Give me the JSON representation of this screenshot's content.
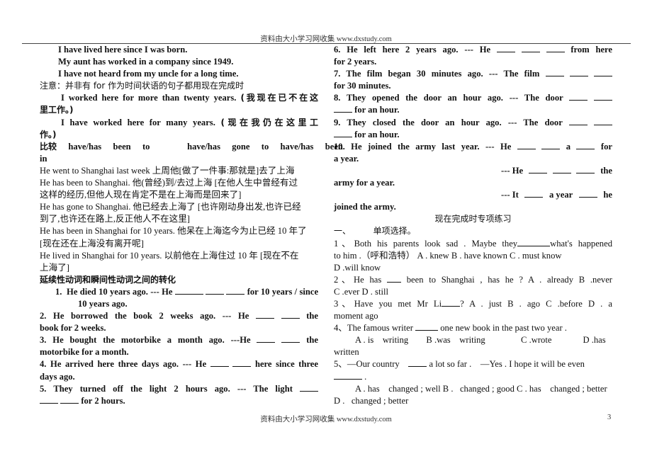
{
  "header": {
    "text": "资料由大小学习网收集  www.dxstudy.com"
  },
  "footer": {
    "text": "资料由大小学习网收集  www.dxstudy.com",
    "page_number": "3"
  },
  "left_column": {
    "examples": [
      "I have lived here since I was born.",
      "My aunt has worked in a company since 1949.",
      "I have not heard from my uncle for a long time."
    ],
    "note_label": "注意：并非有 for  作为时间状语的句子都用现在完成时",
    "note_ex1": {
      "en": "I worked here for more than twenty years.",
      "cn_a": "(我现在已不在这",
      "cn_b": "里工作。)"
    },
    "note_ex2": {
      "en": "I have worked here for many years.",
      "cn_a": "(现在我仍在这里工",
      "cn_b": "作。)"
    },
    "compare": {
      "label": "比较",
      "items": [
        "have/has",
        "been",
        "to",
        "have/has",
        "gone",
        "to",
        "have/has",
        "been"
      ],
      "wrap": "in"
    },
    "sentences": [
      {
        "text": "He went to Shanghai last week   上周他[做了一件事:那就是]去了上海"
      },
      {
        "text": "He has been to Shanghai.  他(曾经)到/去过上海    [在他人生中曾经有过",
        "cont": "这样的经历,但他人现在肯定不是在上海而是回来了]"
      },
      {
        "text": "He has gone to Shanghai.  他已经去上海了  [也许刚动身出发,也许已经",
        "cont": "到了,也许还在路上,反正他人不在这里]"
      },
      {
        "text": "He has been in Shanghai for 10 years.  他呆在上海迄今为止已经 10 年了",
        "cont": "[现在还在上海没有离开呢]"
      },
      {
        "text": "He lived in Shanghai for 10 years.  以前他在上海住过 10 年    [现在不在",
        "cont": "上海了]"
      }
    ],
    "conversion_title": "延续性动词和瞬间性动词之间的转化",
    "exercises": [
      {
        "num": "1.",
        "a": "He died 10 years ago. --- He",
        "b": "for 10 years / since",
        "cont": "10 years ago."
      },
      {
        "a": "2. He borrowed the book 2 weeks ago.",
        "b": "--- He",
        "c": "the",
        "cont": "book for 2 weeks."
      },
      {
        "a": "3. He bought the motorbike a month ago. ---He",
        "c": "the",
        "cont": "motorbike for a month."
      },
      {
        "a": "4. He arrived here three days ago.    --- He",
        "b": "here since three",
        "cont": "days ago."
      },
      {
        "a": "5. They turned off the light 2 hours ago.",
        "b": "--- The light",
        "cont": "for 2 hours."
      }
    ]
  },
  "right_column": {
    "exercises": [
      {
        "a": "6. He left here 2 years ago.",
        "b": "--- He",
        "c": "from here",
        "cont": "for 2 years."
      },
      {
        "a": "7. The film began 30 minutes ago.",
        "b": "--- The film",
        "cont": "for 30 minutes."
      },
      {
        "a": "8. They opened the door an hour ago.",
        "b": "--- The door",
        "cont": "for an hour."
      },
      {
        "a": "9. They closed the door an hour ago.",
        "b": "--- The door",
        "cont": "for an hour."
      },
      {
        "a": "10. He joined the army last year.",
        "b": "--- He",
        "c": "a",
        "d": "for",
        "cont": "a year."
      },
      {
        "b": "--- He",
        "c": "the",
        "cont": "army for a year."
      },
      {
        "b": "--- It",
        "c": "a  year",
        "d": "he",
        "cont": "joined the army."
      }
    ],
    "section_title": "现在完成时专项练习",
    "section_sub": {
      "num": "一、",
      "label": "单项选择。"
    },
    "questions": [
      {
        "line1": "1、Both   his   parents   look   sad . Maybe   they",
        "line1_end": "what's   happened",
        "line2": "to   him .（呼和浩特） A .   knew     B .   have known    C .   must know",
        "line3": "D .will know"
      },
      {
        "line1": "2、He   has",
        "line1_end": "been   to   Shanghai , has   he ? A .   already B .never",
        "line2": "C .ever    D . still"
      },
      {
        "line1": "3、Have   you   met   Mr   Li",
        "line1_end": "?  A .  just B .   ago C .before   D .   a",
        "line2": "moment ago"
      },
      {
        "line1": "4、The famous writer",
        "line1_end": "one new book in the past two year .",
        "line2": "A . is    writing        B .was    writing                C .wrote              D .has",
        "line3": "written"
      },
      {
        "line1": "5、—Our country",
        "line1_end": "a lot so far .    —Yes . I hope it will be even",
        "line2": "A . has    changed ; well B .   changed ; good C . has    changed ; better",
        "line3": "D .   changed ; better"
      }
    ]
  }
}
